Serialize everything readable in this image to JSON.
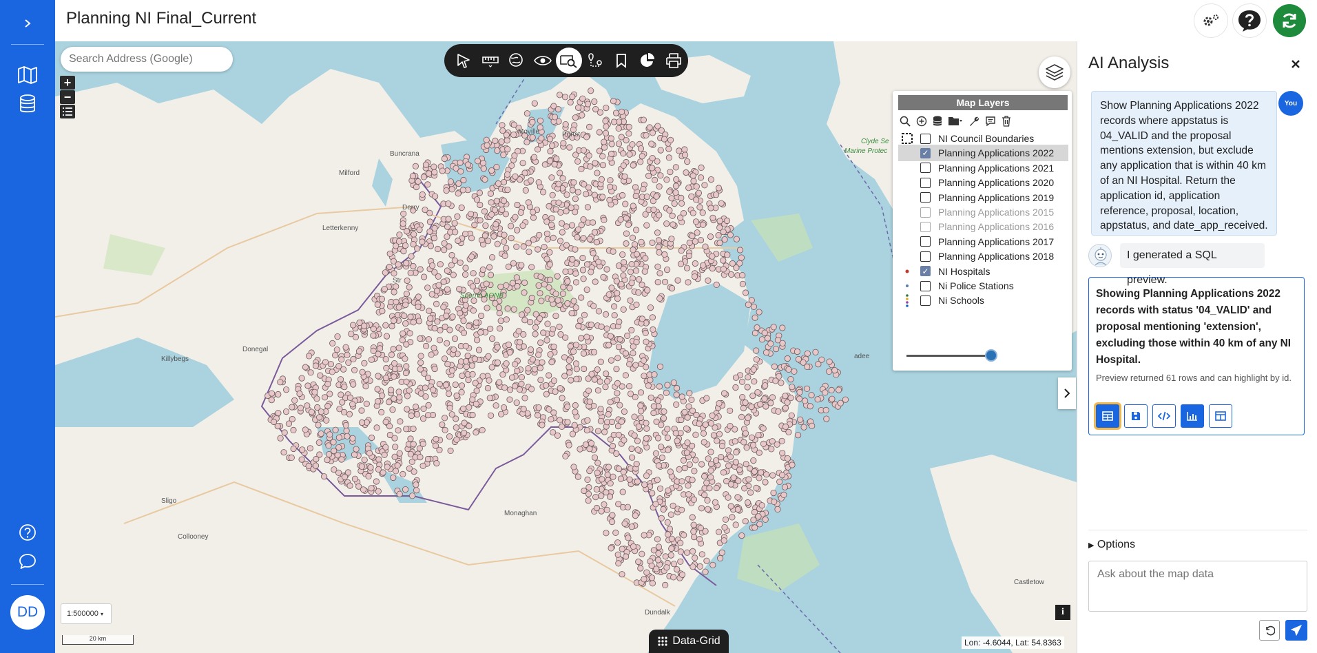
{
  "app": {
    "title": "Planning NI Final_Current",
    "user_initials": "DD"
  },
  "leftnav": {
    "items": [
      {
        "icon": "chevron-right-icon"
      },
      {
        "icon": "map-icon"
      },
      {
        "icon": "database-icon"
      },
      {
        "icon": "help-icon"
      },
      {
        "icon": "chat-icon"
      }
    ]
  },
  "header": {
    "buttons": [
      {
        "icon": "settings-icon"
      },
      {
        "icon": "help-icon"
      },
      {
        "icon": "refresh-icon",
        "color": "#1e8a3c"
      }
    ]
  },
  "map": {
    "search_placeholder": "Search Address (Google)",
    "toolbar": [
      "select-icon",
      "measure-icon",
      "globe-icon",
      "eye-icon",
      "search-map-icon",
      "route-icon",
      "bookmark-icon",
      "pie-chart-icon",
      "print-icon"
    ],
    "active_tool": "search-map-icon",
    "scale": "1:500000",
    "scale_bar": "20 km",
    "data_grid_label": "Data-Grid",
    "info_label": "i",
    "coordinates": "Lon: -4.6044, Lat: 54.8363",
    "places": [
      "Moville",
      "Portst",
      "Buncrana",
      "Milford",
      "Derry",
      "Letterkenny",
      "Str",
      "Sperrin AONB",
      "Donegal",
      "Killybegs",
      "Sligo",
      "Collooney",
      "Monaghan",
      "Dundalk",
      "Clyde Se",
      "Marine Protec",
      "adee",
      "Castletow"
    ]
  },
  "layers": {
    "title": "Map Layers",
    "tools": [
      "search-icon",
      "add-icon",
      "database-icon",
      "folder-icon",
      "wrench-icon",
      "comment-icon",
      "trash-icon"
    ],
    "items": [
      {
        "label": "NI Council Boundaries",
        "checked": false,
        "dim": false,
        "legend": "boundary"
      },
      {
        "label": "Planning Applications 2022",
        "checked": true,
        "dim": false,
        "legend": "none",
        "selected": true
      },
      {
        "label": "Planning Applications 2021",
        "checked": false,
        "dim": false,
        "legend": "none"
      },
      {
        "label": "Planning Applications 2020",
        "checked": false,
        "dim": false,
        "legend": "none"
      },
      {
        "label": "Planning Applications 2019",
        "checked": false,
        "dim": false,
        "legend": "none"
      },
      {
        "label": "Planning Applications 2015",
        "checked": false,
        "dim": true,
        "legend": "none"
      },
      {
        "label": "Planning Applications 2016",
        "checked": false,
        "dim": true,
        "legend": "none"
      },
      {
        "label": "Planning Applications 2017",
        "checked": false,
        "dim": false,
        "legend": "none"
      },
      {
        "label": "Planning Applications 2018",
        "checked": false,
        "dim": false,
        "legend": "none"
      },
      {
        "label": "NI Hospitals",
        "checked": true,
        "dim": false,
        "legend": "red-dot"
      },
      {
        "label": "Ni Police Stations",
        "checked": false,
        "dim": false,
        "legend": "blue-dot"
      },
      {
        "label": "Ni Schools",
        "checked": false,
        "dim": false,
        "legend": "multi"
      }
    ],
    "opacity": 1.0
  },
  "ai": {
    "title": "AI Analysis",
    "user_badge": "You",
    "user_message": "Show Planning Applications 2022 records where appstatus is 04_VALID and the proposal mentions extension, but exclude any application that is within 40 km of an NI Hospital. Return the application id, application reference, proposal, location, appstatus, and date_app_received.",
    "bot_message": "I generated a SQL preview.",
    "result_heading": "Showing Planning Applications 2022 records with status '04_VALID' and proposal mentioning 'extension', excluding those within 40 km of any NI Hospital.",
    "result_sub": "Preview returned 61 rows and can highlight by id.",
    "actions": [
      "table-icon",
      "save-icon",
      "code-icon",
      "chart-icon",
      "columns-icon"
    ],
    "options_label": "Options",
    "input_placeholder": "Ask about the map data"
  }
}
